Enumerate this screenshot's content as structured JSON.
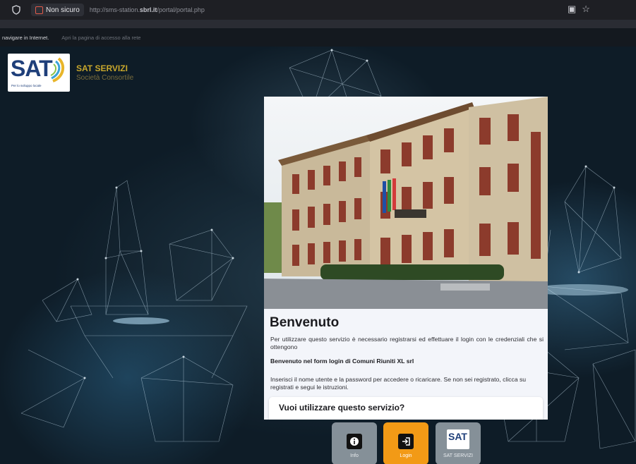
{
  "browser": {
    "security_label": "Non sicuro",
    "url_prefix": "http://sms-station.",
    "url_domain": "sbrl.it",
    "url_path": "/portal/portal.php"
  },
  "hint_bar": {
    "left_text": "navigare in Internet.",
    "right_text": "Apri la pagina di accesso alla rete"
  },
  "header": {
    "logo_text": "SAT",
    "logo_tagline": "Per lo sviluppo locale",
    "brand_title": "SAT SERVIZI",
    "brand_subtitle": "Società Consortile"
  },
  "card": {
    "title": "Benvenuto",
    "intro": "Per utilizzare questo servizio è necessario registrarsi ed effettuare il login con le credenziali che si ottengono",
    "form_title": "Benvenuto nel form login di Comuni Riuniti XL srl",
    "instructions": "Inserisci il nome utente e la password per accedere o ricaricare. Se non sei registrato, clicca su registrati e segui le istruzioni.",
    "question": "Vuoi utilizzare questo servizio?"
  },
  "buttons": {
    "info": "Info",
    "login": "Login",
    "sat": "SAT SERVIZI",
    "sat_icon_text": "SAT"
  },
  "colors": {
    "login_accent": "#f29a16",
    "brand_gold": "#c8a72c",
    "brand_blue": "#1f3f7a"
  }
}
